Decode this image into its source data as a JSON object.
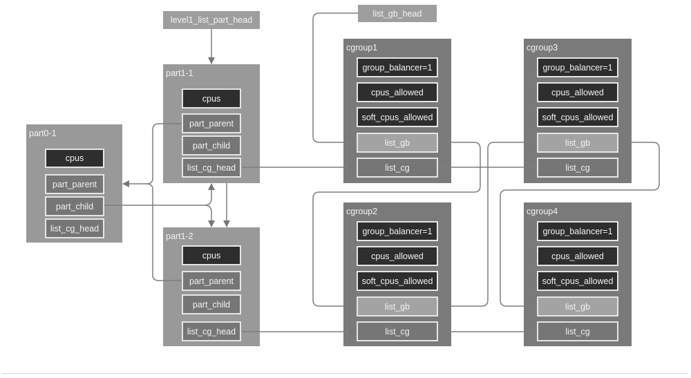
{
  "heads": {
    "level1": "level1_list_part_head",
    "list_gb": "list_gb_head"
  },
  "parts": [
    {
      "id": "part0-1",
      "title": "part0-1",
      "fields": [
        "cpus",
        "part_parent",
        "part_child",
        "list_cg_head"
      ]
    },
    {
      "id": "part1-1",
      "title": "part1-1",
      "fields": [
        "cpus",
        "part_parent",
        "part_child",
        "list_cg_head"
      ]
    },
    {
      "id": "part1-2",
      "title": "part1-2",
      "fields": [
        "cpus",
        "part_parent",
        "part_child",
        "list_cg_head"
      ]
    }
  ],
  "cgroups": [
    {
      "id": "cgroup1",
      "title": "cgroup1",
      "fields": [
        "group_balancer=1",
        "cpus_allowed",
        "soft_cpus_allowed",
        "list_gb",
        "list_cg"
      ]
    },
    {
      "id": "cgroup2",
      "title": "cgroup2",
      "fields": [
        "group_balancer=1",
        "cpus_allowed",
        "soft_cpus_allowed",
        "list_gb",
        "list_cg"
      ]
    },
    {
      "id": "cgroup3",
      "title": "cgroup3",
      "fields": [
        "group_balancer=1",
        "cpus_allowed",
        "soft_cpus_allowed",
        "list_gb",
        "list_cg"
      ]
    },
    {
      "id": "cgroup4",
      "title": "cgroup4",
      "fields": [
        "group_balancer=1",
        "cpus_allowed",
        "soft_cpus_allowed",
        "list_gb",
        "list_cg"
      ]
    }
  ],
  "colors": {
    "part_bg": "#999999",
    "cgroup_bg": "#7a7a7a",
    "field_dark": "#2e2e2e",
    "field_mid": "#767676",
    "field_light": "#a3a3a3",
    "connector": "#777777"
  }
}
